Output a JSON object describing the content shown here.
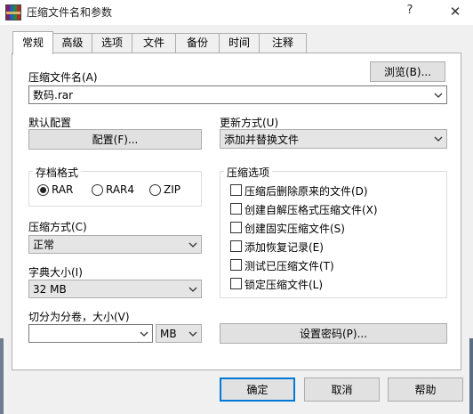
{
  "window": {
    "title": "压缩文件名和参数",
    "help_glyph": "?",
    "close_glyph": "✕"
  },
  "tabs": [
    {
      "label": "常规",
      "active": true
    },
    {
      "label": "高级"
    },
    {
      "label": "选项"
    },
    {
      "label": "文件"
    },
    {
      "label": "备份"
    },
    {
      "label": "时间"
    },
    {
      "label": "注释"
    }
  ],
  "archive": {
    "label": "压缩文件名(A)",
    "value": "数码.rar",
    "browse_label": "浏览(B)..."
  },
  "profile": {
    "label": "默认配置",
    "button_label": "配置(F)..."
  },
  "update": {
    "label": "更新方式(U)",
    "value": "添加并替换文件"
  },
  "format": {
    "title": "存档格式",
    "options": [
      {
        "label": "RAR",
        "checked": true
      },
      {
        "label": "RAR4",
        "checked": false
      },
      {
        "label": "ZIP",
        "checked": false
      }
    ]
  },
  "method": {
    "label": "压缩方式(C)",
    "value": "正常"
  },
  "dictionary": {
    "label": "字典大小(I)",
    "value": "32 MB"
  },
  "split": {
    "label": "切分为分卷，大小(V)",
    "value": "",
    "unit": "MB"
  },
  "options": {
    "title": "压缩选项",
    "items": [
      {
        "label": "压缩后删除原来的文件(D)",
        "checked": false
      },
      {
        "label": "创建自解压格式压缩文件(X)",
        "checked": false
      },
      {
        "label": "创建固实压缩文件(S)",
        "checked": false
      },
      {
        "label": "添加恢复记录(E)",
        "checked": false
      },
      {
        "label": "测试已压缩文件(T)",
        "checked": false
      },
      {
        "label": "锁定压缩文件(L)",
        "checked": false
      }
    ]
  },
  "password_label": "设置密码(P)...",
  "footer": {
    "ok": "确定",
    "cancel": "取消",
    "help": "帮助"
  }
}
